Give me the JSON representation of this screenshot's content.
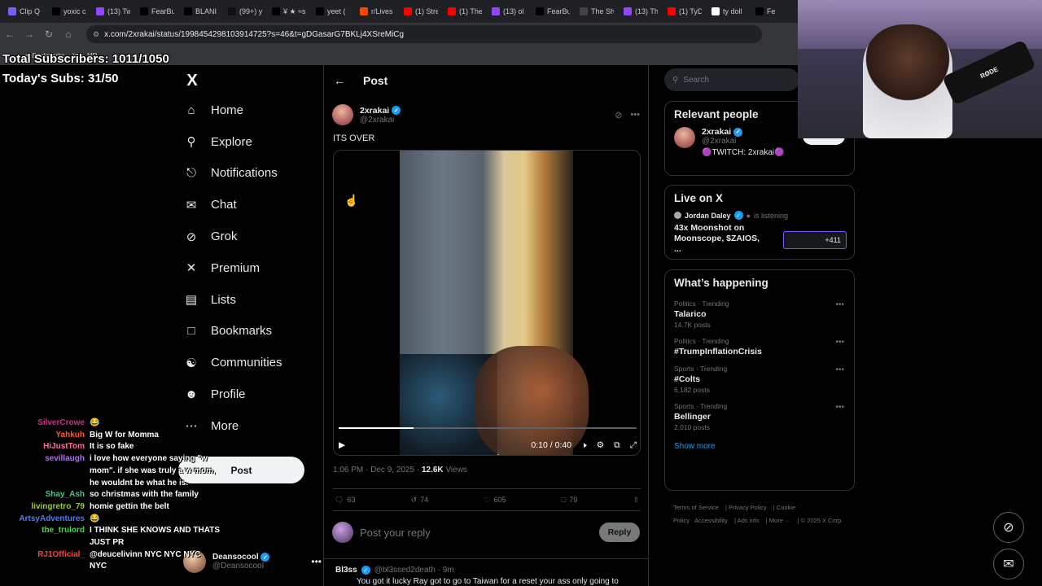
{
  "browser": {
    "tabs": [
      {
        "label": "Clip Q",
        "color": "#7b5cff"
      },
      {
        "label": "yoxic c",
        "color": "#000"
      },
      {
        "label": "(13) Tw",
        "color": "#9146ff"
      },
      {
        "label": "FearBu",
        "color": "#000"
      },
      {
        "label": "BLANI",
        "color": "#000"
      },
      {
        "label": "(99+) y",
        "color": "#111"
      },
      {
        "label": "¥ ★ ≈s",
        "color": "#000"
      },
      {
        "label": "yeet (",
        "color": "#000"
      },
      {
        "label": "r/Lives",
        "color": "#ff4500"
      },
      {
        "label": "(1) Stre",
        "color": "#ff0000"
      },
      {
        "label": "(1) The",
        "color": "#ff0000"
      },
      {
        "label": "(13) ol",
        "color": "#9146ff"
      },
      {
        "label": "FearBu",
        "color": "#000"
      },
      {
        "label": "The Sh",
        "color": "#444"
      },
      {
        "label": "(13) Th",
        "color": "#9146ff"
      },
      {
        "label": "(1) TyD",
        "color": "#ff0000"
      },
      {
        "label": "ty doll",
        "color": "#fff"
      },
      {
        "label": "Fe",
        "color": "#000"
      }
    ],
    "url": "x.com/2xrakai/status/1998454298103914725?s=46&t=gDGasarG7BKLj4XSreMiCg",
    "bookmarks_label": "Bookmarks",
    "bookmark_items": [
      "W",
      "MR"
    ]
  },
  "overlay": {
    "total_subs": "Total Subscribers: 1011/1050",
    "today_subs": "Today's Subs: 31/50"
  },
  "nav": {
    "logo": "X",
    "items": [
      {
        "label": "Home",
        "icon": "home-icon"
      },
      {
        "label": "Explore",
        "icon": "search-icon"
      },
      {
        "label": "Notifications",
        "icon": "bell-icon"
      },
      {
        "label": "Chat",
        "icon": "envelope-icon"
      },
      {
        "label": "Grok",
        "icon": "grok-icon"
      },
      {
        "label": "Premium",
        "icon": "x-icon"
      },
      {
        "label": "Lists",
        "icon": "list-icon"
      },
      {
        "label": "Bookmarks",
        "icon": "bookmark-icon"
      },
      {
        "label": "Communities",
        "icon": "people-icon"
      },
      {
        "label": "Profile",
        "icon": "person-icon"
      },
      {
        "label": "More",
        "icon": "more-circle-icon"
      }
    ],
    "post_label": "Post",
    "account": {
      "name": "Deansocool",
      "handle": "@Deansocool"
    }
  },
  "post": {
    "header": "Post",
    "author_name": "2xrakai",
    "author_handle": "@2xrakai",
    "text": "ITS OVER",
    "video": {
      "time": "0:10 / 0:40",
      "progress": 0.25
    },
    "time": "1:06 PM · Dec 9, 2025 · ",
    "views_count": "12.6K",
    "views_label": " Views",
    "replies": "63",
    "reposts": "74",
    "likes": "605",
    "bookmarks": "79",
    "reply_placeholder": "Post your reply",
    "reply_button": "Reply"
  },
  "next_tweet": {
    "name": "Bl3ss",
    "handle": "@bl3ssed2death · 9m",
    "text": "You got it lucky Ray got to go to Taiwan for a reset your ass only going to"
  },
  "sidebar": {
    "search_placeholder": "Search",
    "relevant_title": "Relevant people",
    "relevant": {
      "name": "2xrakai",
      "handle": "@2xrakai",
      "bio": "🟣TWITCH: 2xrakai🟣",
      "follow": "Follow"
    },
    "live_title": "Live on X",
    "live": {
      "host": "Jordan Daley",
      "status": "is listening",
      "title": "43x Moonshot on Moonscope, $ZAIOS, ...",
      "count": "+411"
    },
    "happening_title": "What’s happening",
    "trends": [
      {
        "category": "Politics · Trending",
        "title": "Talarico",
        "count": "14.7K posts"
      },
      {
        "category": "Politics · Trending",
        "title": "#TrumpInflationCrisis",
        "count": ""
      },
      {
        "category": "Sports · Trending",
        "title": "#Colts",
        "count": "6,182 posts"
      },
      {
        "category": "Sports · Trending",
        "title": "Bellinger",
        "count": "2,010 posts"
      }
    ],
    "show_more": "Show more",
    "footer": [
      "Terms of Service",
      "Privacy Policy",
      "Cookie Policy",
      "Accessibility",
      "Ads info",
      "More ···",
      "© 2025 X Corp."
    ]
  },
  "webcam": {
    "mic_label": "RØDE"
  },
  "chat": [
    {
      "user": "SilverCrowe",
      "msg": "😂",
      "color": "#d62a8b"
    },
    {
      "user": "Yahkuh",
      "msg": "Big W for Momma",
      "color": "#ff5a36"
    },
    {
      "user": "HiJustTom",
      "msg": "It is so fake",
      "color": "#ff6aa3"
    },
    {
      "user": "sevillaugh",
      "msg": "i love how everyone saying \"w mom\". if she was truly a w mom, he wouldnt be what he is.",
      "color": "#b36bff"
    },
    {
      "user": "Shay_Ash",
      "msg": "so christmas with the family",
      "color": "#35d07f"
    },
    {
      "user": "livingretro_79",
      "msg": "homie gettin the belt",
      "color": "#9acd32"
    },
    {
      "user": "ArtsyAdventures",
      "msg": "😂",
      "color": "#4a7dff"
    },
    {
      "user": "the_trulord",
      "msg": "I THINK SHE KNOWS AND THATS JUST PR",
      "color": "#3fe03f"
    },
    {
      "user": "RJ1Official_",
      "msg": "@deucelivinn NYC NYC NYC NYC",
      "color": "#ff4040"
    }
  ]
}
